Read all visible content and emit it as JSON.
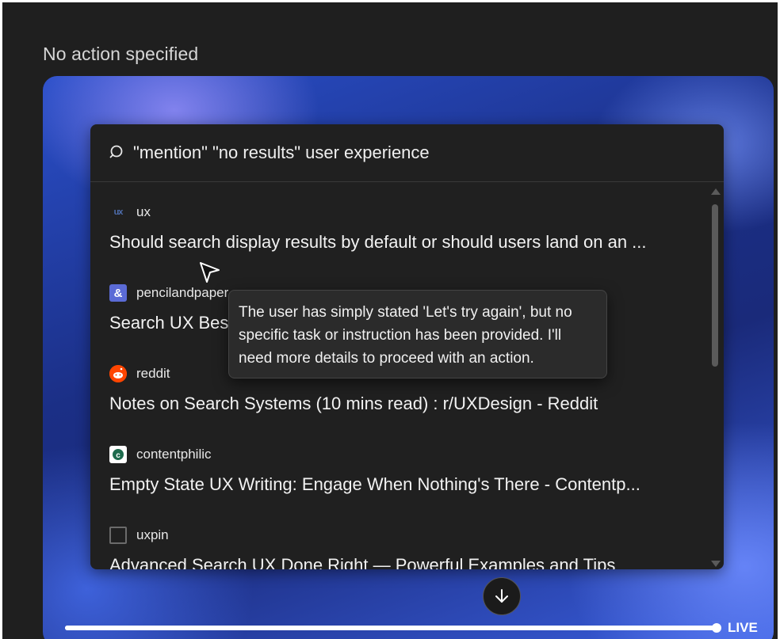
{
  "header": {
    "title": "No action specified"
  },
  "search": {
    "query": "\"mention\" \"no results\" user experience"
  },
  "results": [
    {
      "source": "ux",
      "favicon": "ux-logo-icon",
      "title": "Should search display results by default or should users land on an ..."
    },
    {
      "source": "pencilandpaper",
      "favicon": "ampersand-icon",
      "title": "Search UX Best Practices"
    },
    {
      "source": "reddit",
      "favicon": "reddit-icon",
      "title": "Notes on Search Systems (10 mins read) : r/UXDesign - Reddit"
    },
    {
      "source": "contentphilic",
      "favicon": "contentphilic-icon",
      "title": "Empty State UX Writing: Engage When Nothing's There - Contentp..."
    },
    {
      "source": "uxpin",
      "favicon": "uxpin-icon",
      "title": "Advanced Search UX Done Right — Powerful Examples and Tips"
    }
  ],
  "tooltip": {
    "text": "The user has simply stated 'Let's try again', but no specific task or instruction has been provided. I'll need more details to proceed with an action."
  },
  "playback": {
    "progress": 1.0,
    "live_label": "LIVE"
  },
  "colors": {
    "reddit": "#ff4500",
    "pencilandpaper": "#5b6bd6",
    "contentphilic": "#1e6b4d"
  }
}
